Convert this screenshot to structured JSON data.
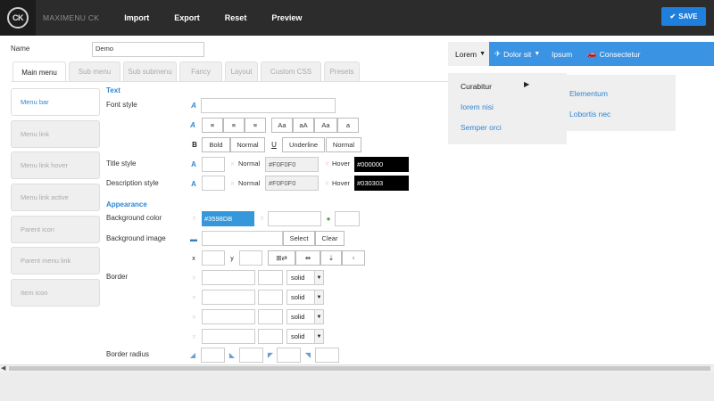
{
  "app": {
    "logo": "CK",
    "title": "MAXIMENU CK",
    "nav": [
      "Import",
      "Export",
      "Reset",
      "Preview"
    ],
    "save_label": "SAVE"
  },
  "name": {
    "label": "Name",
    "value": "Demo"
  },
  "tabs": [
    "Main menu",
    "Sub menu",
    "Sub submenu",
    "Fancy",
    "Layout",
    "Custom CSS",
    "Presets"
  ],
  "left_menu": [
    "Menu bar",
    "Menu link",
    "Menu link hover",
    "Menu link active",
    "Parent icon",
    "Parent menu link",
    "Item icon"
  ],
  "text_section": {
    "heading": "Text",
    "font_style_label": "Font style",
    "align_icons": [
      "align-left-icon",
      "align-center-icon",
      "align-right-icon"
    ],
    "case_buttons": [
      "Aa",
      "aA",
      "Aa",
      "a"
    ],
    "bold_buttons": [
      "Bold",
      "Normal"
    ],
    "underline_buttons": [
      "Underline",
      "Normal"
    ],
    "title_style_label": "Title style",
    "description_style_label": "Description style",
    "normal_label": "Normal",
    "hover_label": "Hover",
    "title_normal_color": "#F0F0F0",
    "title_hover_color": "#000000",
    "desc_normal_color": "#F0F0F0",
    "desc_hover_color": "#030303"
  },
  "appearance": {
    "heading": "Appearance",
    "bg_color_label": "Background color",
    "bg_color_value": "#3598DB",
    "bg_image_label": "Background image",
    "select_label": "Select",
    "clear_label": "Clear",
    "border_label": "Border",
    "border_styles": [
      "solid",
      "solid",
      "solid",
      "solid"
    ],
    "border_radius_label": "Border radius"
  },
  "preview": {
    "items": [
      "Lorem",
      "Dolor sit",
      "Ipsum",
      "Consectetur"
    ],
    "submenu": [
      "Curabitur",
      "Iorem nisi",
      "Semper orci"
    ],
    "subsubmenu": [
      "Elementum",
      "Lobortis nec"
    ]
  },
  "colors": {
    "accent": "#3598DB",
    "save": "#1E7FDC",
    "topbar": "#2C2C2C"
  }
}
